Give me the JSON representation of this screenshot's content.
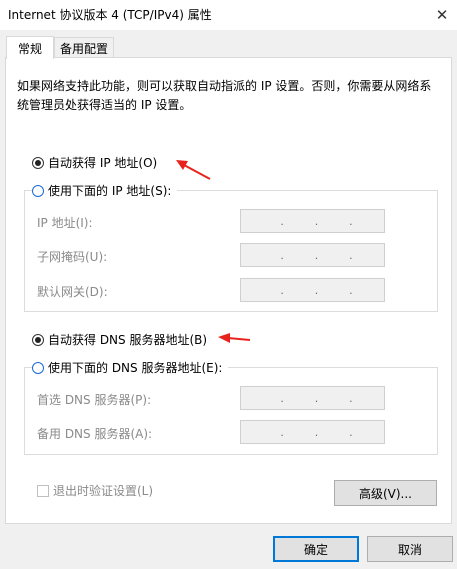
{
  "window": {
    "title": "Internet 协议版本 4 (TCP/IPv4) 属性",
    "close_glyph": "✕"
  },
  "tabs": [
    {
      "label": "常规",
      "active": true
    },
    {
      "label": "备用配置",
      "active": false
    }
  ],
  "description": "如果网络支持此功能，则可以获取自动指派的 IP 设置。否则，你需要从网络系统管理员处获得适当的 IP 设置。",
  "ip_section": {
    "auto_option": "自动获得 IP 地址(O)",
    "manual_option": "使用下面的 IP 地址(S):",
    "auto_selected": true,
    "fields": [
      {
        "label": "IP 地址(I):"
      },
      {
        "label": "子网掩码(U):"
      },
      {
        "label": "默认网关(D):"
      }
    ]
  },
  "dns_section": {
    "auto_option": "自动获得 DNS 服务器地址(B)",
    "manual_option": "使用下面的 DNS 服务器地址(E):",
    "auto_selected": true,
    "fields": [
      {
        "label": "首选 DNS 服务器(P):"
      },
      {
        "label": "备用 DNS 服务器(A):"
      }
    ]
  },
  "validate_checkbox": {
    "label": "退出时验证设置(L)",
    "checked": false
  },
  "buttons": {
    "advanced": "高级(V)...",
    "ok": "确定",
    "cancel": "取消"
  },
  "ip_placeholder_dot": ".",
  "colors": {
    "accent": "#0078d7",
    "annotation_arrow": "#e8231e"
  }
}
